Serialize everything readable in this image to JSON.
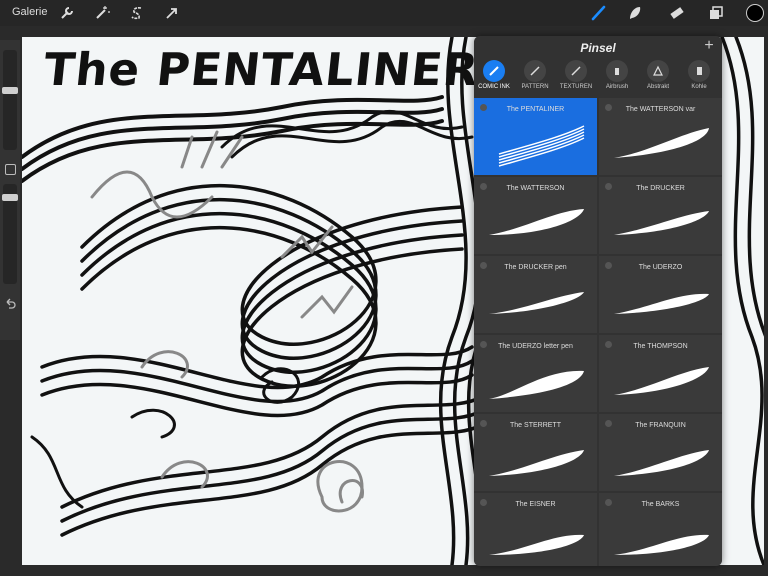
{
  "toolbar": {
    "gallery_label": "Galerie",
    "left_icons": [
      "wrench-icon",
      "magic-wand-icon",
      "selection-s-icon",
      "arrow-cursor-icon"
    ],
    "right_icons": [
      "brush-icon",
      "smudge-icon",
      "eraser-icon",
      "layers-icon"
    ],
    "current_color": "#000000"
  },
  "canvas": {
    "title_text": "The PENTALINER"
  },
  "brush_panel": {
    "title": "Pinsel",
    "categories": [
      {
        "label": "COMIC INK",
        "active": true
      },
      {
        "label": "PATTERN"
      },
      {
        "label": "TEXTUREN"
      },
      {
        "label": "Airbrush"
      },
      {
        "label": "Abstrakt"
      },
      {
        "label": "Kohle"
      }
    ],
    "brushes": [
      {
        "name": "The PENTALINER"
      },
      {
        "name": "The WATTERSON var"
      },
      {
        "name": "The WATTERSON"
      },
      {
        "name": "The DRUCKER"
      },
      {
        "name": "The DRUCKER pen"
      },
      {
        "name": "The UDERZO"
      },
      {
        "name": "The UDERZO letter pen"
      },
      {
        "name": "The THOMPSON"
      },
      {
        "name": "The STERRETT"
      },
      {
        "name": "The FRANQUIN"
      },
      {
        "name": "The EISNER"
      },
      {
        "name": "The BARKS"
      }
    ],
    "selected_brush": "The PENTALINER",
    "accent_color": "#1a6ee0"
  }
}
